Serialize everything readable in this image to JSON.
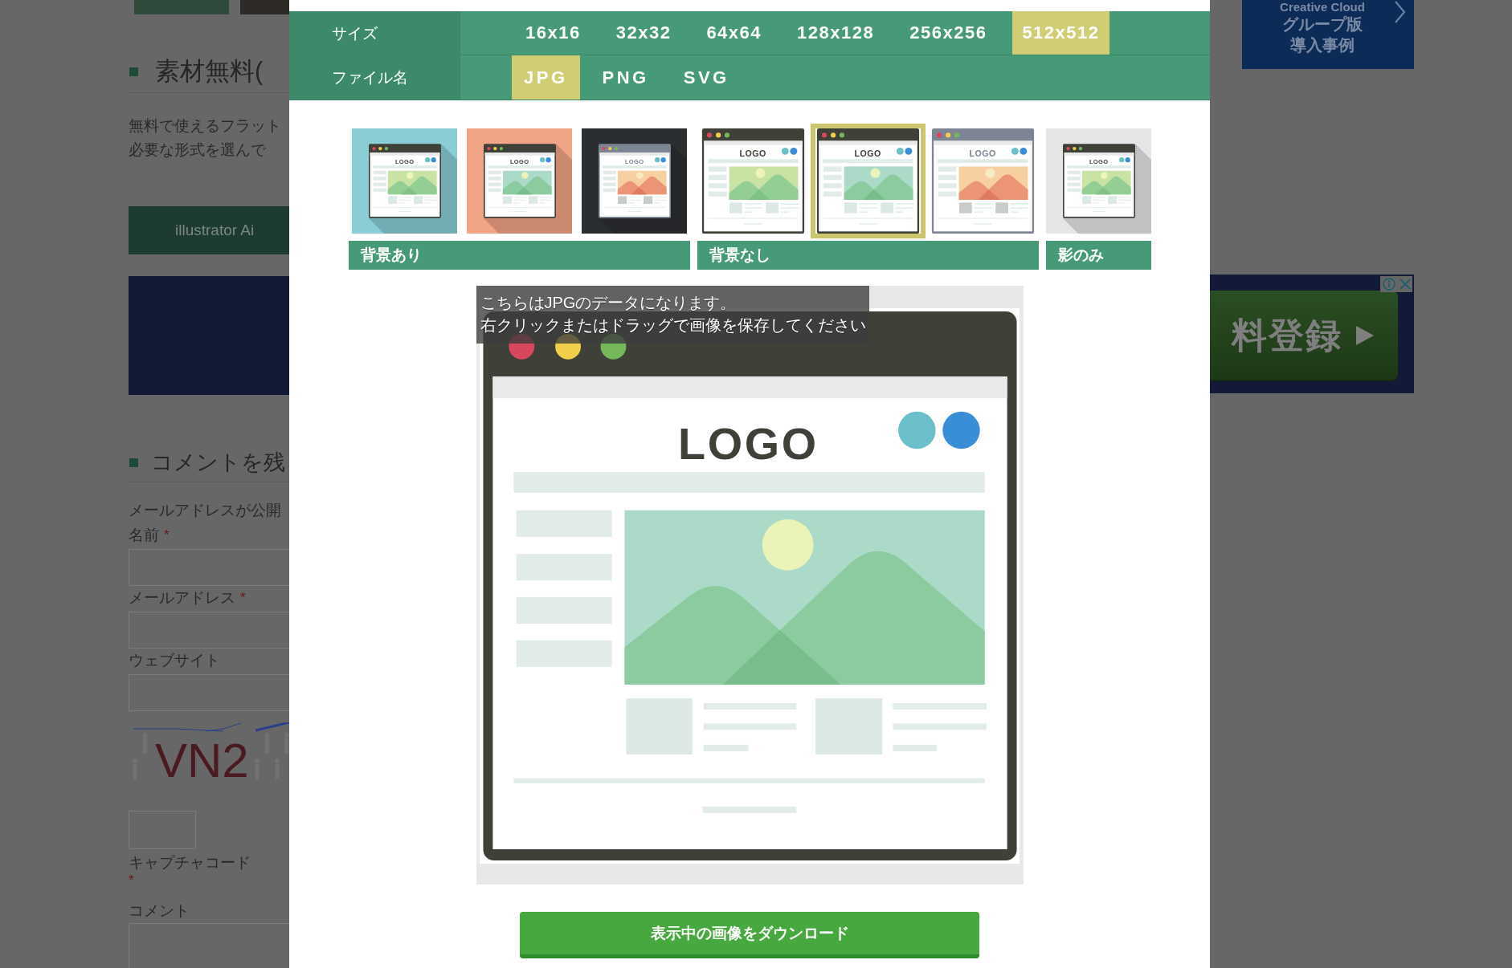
{
  "page": {
    "title": "素材無料(",
    "description": [
      "無料で使えるフラット",
      "必要な形式を選んで"
    ],
    "format_button": "illustrator Ai",
    "comment_title": "コメントを残",
    "comment_note": "メールアドレスが公開",
    "fields": [
      {
        "label": "名前",
        "mark": "*"
      },
      {
        "label": "メールアドレス",
        "mark": "*"
      },
      {
        "label": "ウェブサイト"
      }
    ],
    "captcha": {
      "image_text": "VN2",
      "label": "キャプチャコード",
      "mark": "*"
    },
    "comment_label": "コメント"
  },
  "ads": {
    "top": [
      "Creative Cloud",
      "グループ版",
      "導入事例"
    ],
    "banner": "料登録"
  },
  "dialog": {
    "options": [
      {
        "label": "サイズ",
        "kind": "size",
        "choices": [
          {
            "label": "16x16",
            "selected": false
          },
          {
            "label": "32x32",
            "selected": false
          },
          {
            "label": "64x64",
            "selected": false
          },
          {
            "label": "128x128",
            "selected": false
          },
          {
            "label": "256x256",
            "selected": false
          },
          {
            "label": "512x512",
            "selected": true
          }
        ]
      },
      {
        "label": "ファイル名",
        "kind": "format",
        "choices": [
          {
            "label": "JPG",
            "selected": true
          },
          {
            "label": "PNG",
            "selected": false
          },
          {
            "label": "SVG",
            "selected": false
          }
        ]
      }
    ],
    "thumbnail_groups": [
      {
        "label": "背景あり",
        "kind": "tile",
        "thumbnails": [
          {
            "kind": "green",
            "color": "#8acdd4",
            "logo": "LOGO",
            "selected": false
          },
          {
            "kind": "teal",
            "color": "#f2a486",
            "logo": "LOGO",
            "selected": false
          },
          {
            "kind": "orange",
            "color": "#2b2e31",
            "logo": "LOGO",
            "selected": false
          }
        ]
      },
      {
        "label": "背景なし",
        "kind": "plain",
        "thumbnails": [
          {
            "kind": "green",
            "logo": "LOGO",
            "selected": false
          },
          {
            "kind": "teal",
            "logo": "LOGO",
            "selected": true
          },
          {
            "kind": "orange",
            "logo": "LOGO",
            "selected": false
          }
        ]
      },
      {
        "label": "影のみ",
        "kind": "tile",
        "thumbnails": [
          {
            "kind": "green",
            "color": "#e6e6e6",
            "logo": "LOGO",
            "selected": false
          }
        ]
      }
    ],
    "preview": {
      "logo": "LOGO",
      "tooltip": [
        "こちらはJPGのデータになります。",
        "右クリックまたはドラッグで画像を保存してください"
      ]
    },
    "download_button": "表示中の画像をダウンロード"
  }
}
